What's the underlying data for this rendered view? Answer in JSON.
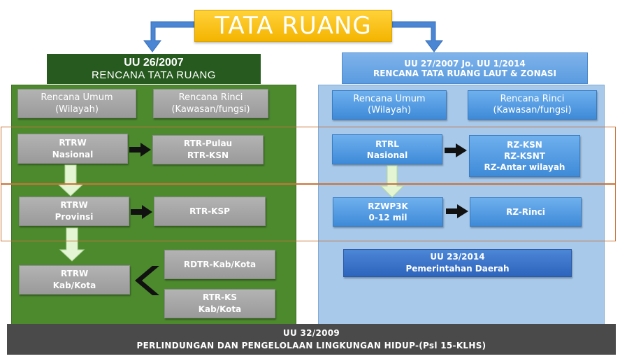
{
  "title": "TATA RUANG",
  "left": {
    "header_line1": "UU 26/2007",
    "header_line2": "RENCANA TATA RUANG",
    "col_umum": [
      "Rencana Umum",
      "(Wilayah)"
    ],
    "col_rinci": [
      "Rencana Rinci",
      "(Kawasan/fungsi)"
    ],
    "rtrw_nasional": [
      "RTRW",
      "Nasional"
    ],
    "rtr_pulau": [
      "RTR-Pulau",
      "RTR-KSN"
    ],
    "rtrw_provinsi": [
      "RTRW",
      "Provinsi"
    ],
    "rtr_ksp": "RTR-KSP",
    "rtrw_kabkota": [
      "RTRW",
      "Kab/Kota"
    ],
    "rdtr": "RDTR-Kab/Kota",
    "rtr_ks": [
      "RTR-KS",
      "Kab/Kota"
    ]
  },
  "right": {
    "header_line1": "UU 27/2007 Jo. UU 1/2014",
    "header_line2": "RENCANA TATA RUANG LAUT & ZONASI",
    "col_umum": [
      "Rencana Umum",
      "(Wilayah)"
    ],
    "col_rinci": [
      "Rencana Rinci",
      "(Kawasan/fungsi)"
    ],
    "rtrl_nasional": [
      "RTRL",
      "Nasional"
    ],
    "rz_ksn": [
      "RZ-KSN",
      "RZ-KSNT",
      "RZ-Antar wilayah"
    ],
    "rzwp3k": [
      "RZWP3K",
      "0-12 mil"
    ],
    "rz_rinci": "RZ-Rinci",
    "uu23": [
      "UU 23/2014",
      "Pemerintahan Daerah"
    ]
  },
  "bottom": {
    "line1": "UU 32/2009",
    "line2": "PERLINDUNGAN DAN PENGELOLAAN LINGKUNGAN HIDUP-(Psl 15-KLHS)"
  },
  "colors": {
    "title_yellow": "#f4b400",
    "left_panel_green": "#4d8a2e",
    "left_header_green": "#265a1e",
    "right_panel_blue": "#a8c9ea",
    "box_blue": "#3e8ad8",
    "box_gray": "#9a9a9a",
    "connector_blue": "#4a86d4",
    "row_outline_orange": "#c8743a",
    "bottom_bar_gray": "#4a4a4a"
  }
}
